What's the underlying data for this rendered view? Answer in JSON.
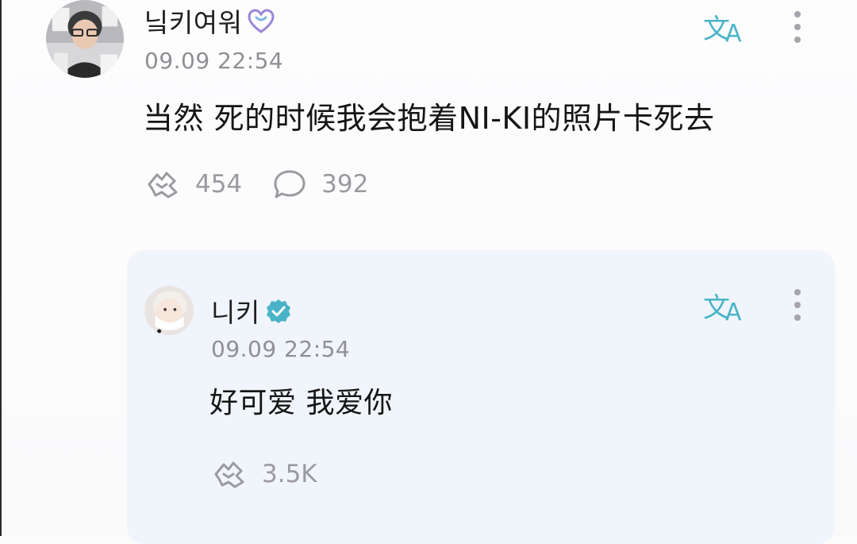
{
  "post": {
    "username": "닠키여워",
    "badge_icon": "heart-outline-icon",
    "timestamp": "09.09 22:54",
    "text": "当然 死的时候我会抱着NI-KI的照片卡死去",
    "like_count": "454",
    "comment_count": "392"
  },
  "reply": {
    "username": "니키",
    "badge_icon": "verified-badge-icon",
    "timestamp": "09.09 22:54",
    "text": "好可爱 我爱你",
    "like_count": "3.5K"
  },
  "colors": {
    "accent": "#4ab3c8",
    "reply_background": "#f0f5fb",
    "secondary_text": "#8f8f94"
  }
}
